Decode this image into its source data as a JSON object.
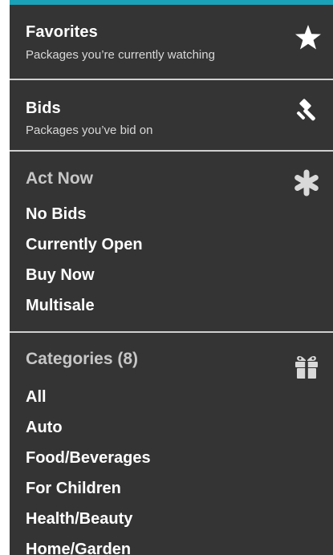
{
  "favorites": {
    "title": "Favorites",
    "subtitle": "Packages you’re currently watching",
    "icon": "star-icon"
  },
  "bids": {
    "title": "Bids",
    "subtitle": "Packages you’ve bid on",
    "icon": "gavel-icon"
  },
  "act_now": {
    "heading": "Act Now",
    "icon": "asterisk-icon",
    "items": [
      "No Bids",
      "Currently Open",
      "Buy Now",
      "Multisale"
    ]
  },
  "categories": {
    "heading": "Categories (8)",
    "icon": "gift-icon",
    "items": [
      "All",
      "Auto",
      "Food/Beverages",
      "For Children",
      "Health/Beauty",
      "Home/Garden"
    ]
  },
  "colors": {
    "panel_bg": "#343434",
    "accent_top_border": "#1aa3b8",
    "divider": "#cfcfcf",
    "heading_text": "#c6c6c6"
  }
}
